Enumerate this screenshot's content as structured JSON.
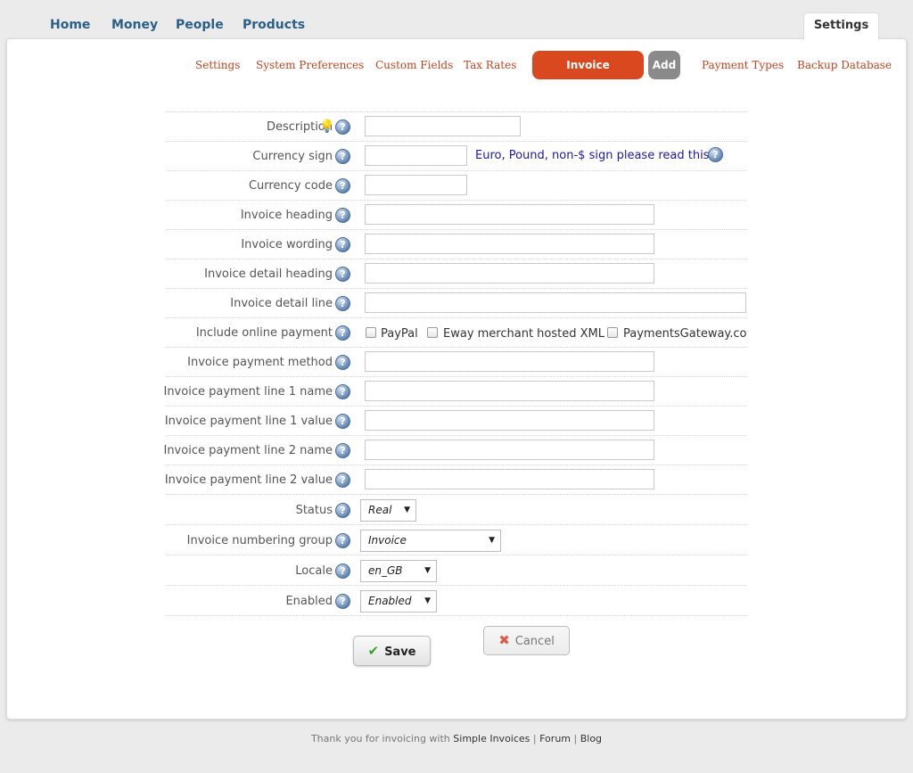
{
  "topnav": {
    "items": [
      {
        "label": "Home"
      },
      {
        "label": "Money"
      },
      {
        "label": "People"
      },
      {
        "label": "Products"
      }
    ],
    "settings_tab": "Settings"
  },
  "subnav": {
    "items": [
      {
        "label": "Settings"
      },
      {
        "label": "System Preferences"
      },
      {
        "label": "Custom Fields"
      },
      {
        "label": "Tax Rates"
      },
      {
        "label": "Invoice Preferences"
      },
      {
        "label": "Add"
      },
      {
        "label": "Payment Types"
      },
      {
        "label": "Backup Database"
      }
    ],
    "active": "Invoice Preferences"
  },
  "form": {
    "description": {
      "label": "Description",
      "value": ""
    },
    "currency_sign": {
      "label": "Currency sign",
      "value": "",
      "note": "Euro, Pound, non-$ sign please read this"
    },
    "currency_code": {
      "label": "Currency code",
      "value": ""
    },
    "invoice_heading": {
      "label": "Invoice heading",
      "value": ""
    },
    "invoice_wording": {
      "label": "Invoice wording",
      "value": ""
    },
    "invoice_detail_heading": {
      "label": "Invoice detail heading",
      "value": ""
    },
    "invoice_detail_line": {
      "label": "Invoice detail line",
      "value": ""
    },
    "online_payment": {
      "label": "Include online payment",
      "options": [
        {
          "label": "PayPal",
          "checked": false
        },
        {
          "label": "Eway merchant hosted XML",
          "checked": false
        },
        {
          "label": "PaymentsGateway.com",
          "checked": false
        }
      ]
    },
    "payment_method": {
      "label": "Invoice payment method",
      "value": ""
    },
    "payment_line1_name": {
      "label": "Invoice payment line 1 name",
      "value": ""
    },
    "payment_line1_value": {
      "label": "Invoice payment line 1 value",
      "value": ""
    },
    "payment_line2_name": {
      "label": "Invoice payment line 2 name",
      "value": ""
    },
    "payment_line2_value": {
      "label": "Invoice payment line 2 value",
      "value": ""
    },
    "status": {
      "label": "Status",
      "value": "Real"
    },
    "numbering_group": {
      "label": "Invoice numbering group",
      "value": "Invoice"
    },
    "locale": {
      "label": "Locale",
      "value": "en_GB"
    },
    "enabled": {
      "label": "Enabled",
      "value": "Enabled"
    }
  },
  "buttons": {
    "save": "Save",
    "cancel": "Cancel"
  },
  "footer": {
    "text": "Thank you for invoicing with",
    "link1": "Simple Invoices",
    "sep": "|",
    "link2": "Forum",
    "link3": "Blog"
  },
  "colors": {
    "accent": "#d9481e",
    "nav_link": "#2a5f8a",
    "subnav_link": "#c0441f",
    "note_link": "#1a1aa6"
  }
}
